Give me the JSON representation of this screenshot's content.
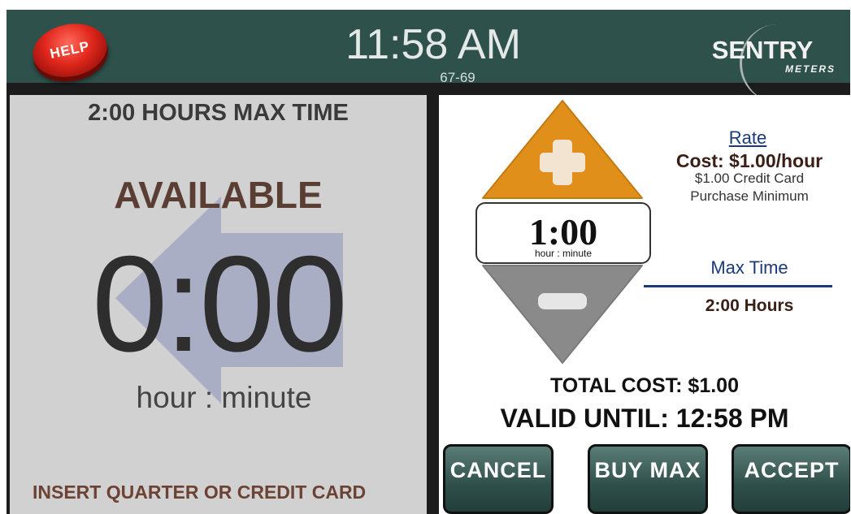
{
  "header": {
    "help_label": "HELP",
    "clock": "11:58 AM",
    "zone": "67-69",
    "logo_main": "SENTRY",
    "logo_sub": "METERS",
    "bg_color": "#2e514b"
  },
  "left": {
    "max_time": "2:00 HOURS MAX TIME",
    "status": "AVAILABLE",
    "time_remaining": "0:00",
    "time_unit": "hour : minute",
    "instruction": "INSERT QUARTER OR CREDIT CARD",
    "icon": "arrow-left-icon"
  },
  "right": {
    "plus_icon": "plus-icon",
    "minus_icon": "minus-icon",
    "selected_time": "1:00",
    "selected_time_unit": "hour : minute",
    "rate": {
      "heading": "Rate",
      "cost": "Cost: $1.00/hour",
      "note_line1": "$1.00 Credit Card",
      "note_line2": "Purchase Minimum"
    },
    "max_time": {
      "heading": "Max Time",
      "value": "2:00 Hours"
    },
    "total_cost": "TOTAL COST: $1.00",
    "valid_until": "VALID UNTIL: 12:58 PM"
  },
  "buttons": {
    "cancel": "CANCEL",
    "buy_max": "BUY MAX",
    "accept": "ACCEPT"
  },
  "colors": {
    "plus_button": "#e0901a",
    "minus_button": "#8a8a8a",
    "accent_text": "#1a3a7a"
  }
}
